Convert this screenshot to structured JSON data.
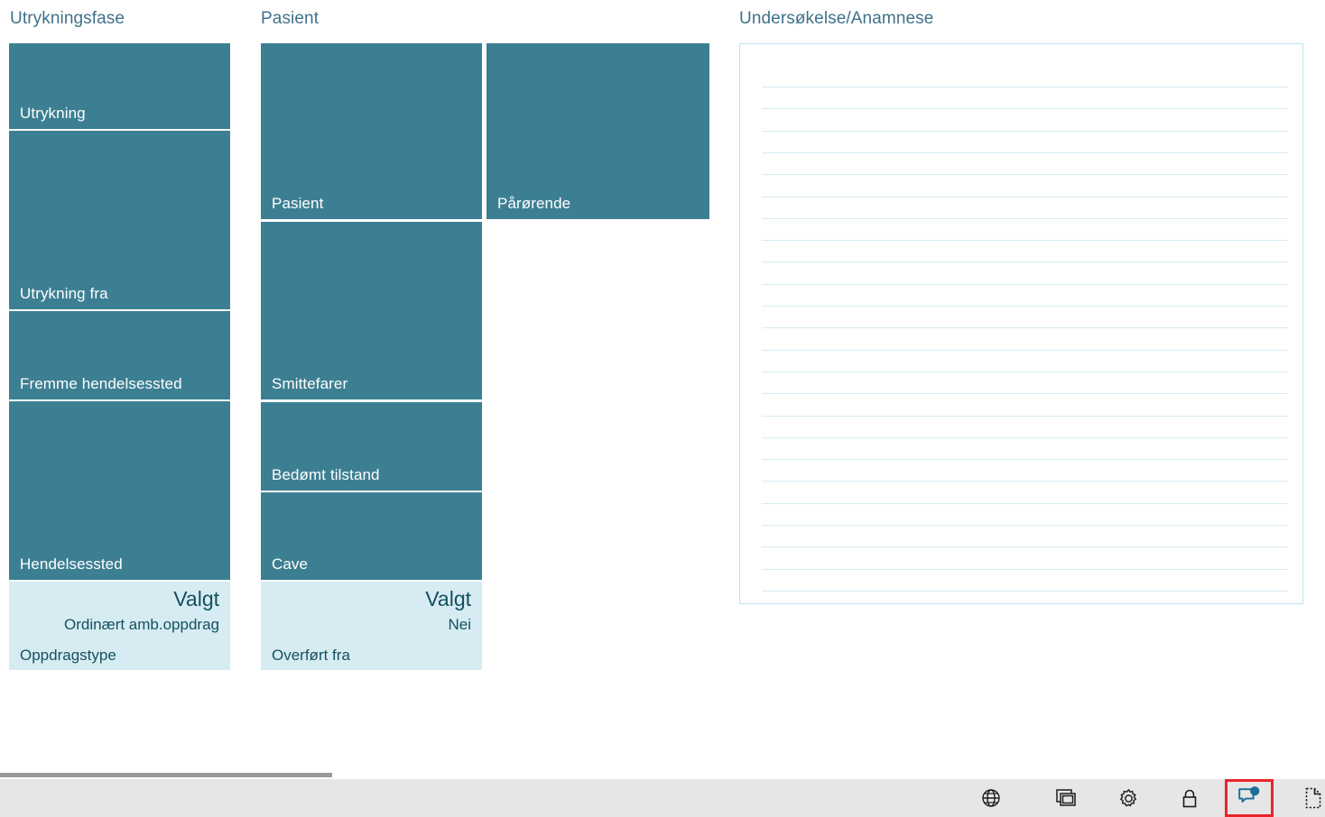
{
  "columns": [
    {
      "header": "Utrykningsfase",
      "tiles": [
        {
          "label": "Utrykning"
        },
        {
          "label": "Utrykning fra"
        },
        {
          "label": "Fremme hendelsessted"
        },
        {
          "label": "Hendelsessted"
        }
      ],
      "selected": {
        "title": "Valgt",
        "value": "Ordinært amb.oppdrag",
        "field": "Oppdragstype"
      }
    },
    {
      "header": "Pasient",
      "tiles": [
        {
          "label": "Pasient"
        },
        {
          "label": "Pårørende"
        },
        {
          "label": "Smittefarer"
        },
        {
          "label": "Bedømt tilstand"
        },
        {
          "label": "Cave"
        }
      ],
      "selected": {
        "title": "Valgt",
        "value": "Nei",
        "field": "Overført fra"
      }
    },
    {
      "header": "Undersøkelse/Anamnese",
      "tiles": [],
      "selected": null
    }
  ],
  "notes": {
    "content": "",
    "placeholder": "",
    "line_count": 25
  },
  "toolbar": {
    "items": [
      {
        "icon": "globe-icon",
        "label": "Språk",
        "selected": false
      },
      {
        "icon": "windows-icon",
        "label": "Vinduer",
        "selected": false
      },
      {
        "icon": "gear-icon",
        "label": "Innstillinger",
        "selected": false
      },
      {
        "icon": "lock-icon",
        "label": "Lås",
        "selected": false
      },
      {
        "icon": "chat-icon",
        "label": "Meldinger",
        "selected": true
      },
      {
        "icon": "document-icon",
        "label": "Dokument",
        "selected": false
      }
    ]
  },
  "colors": {
    "tile": "#3d7f92",
    "tile_text": "#ffffff",
    "selected_tile": "#d6ecf2",
    "selected_text": "#15505f",
    "header_text": "#40718a",
    "notes_border": "#bfe3ee",
    "notes_rule": "#d6ecf4",
    "bar_bg": "#e6e6e6",
    "accent_blue": "#1a6e96",
    "selection_red": "#e8252a",
    "scrollbar": "#9a9a9a"
  }
}
